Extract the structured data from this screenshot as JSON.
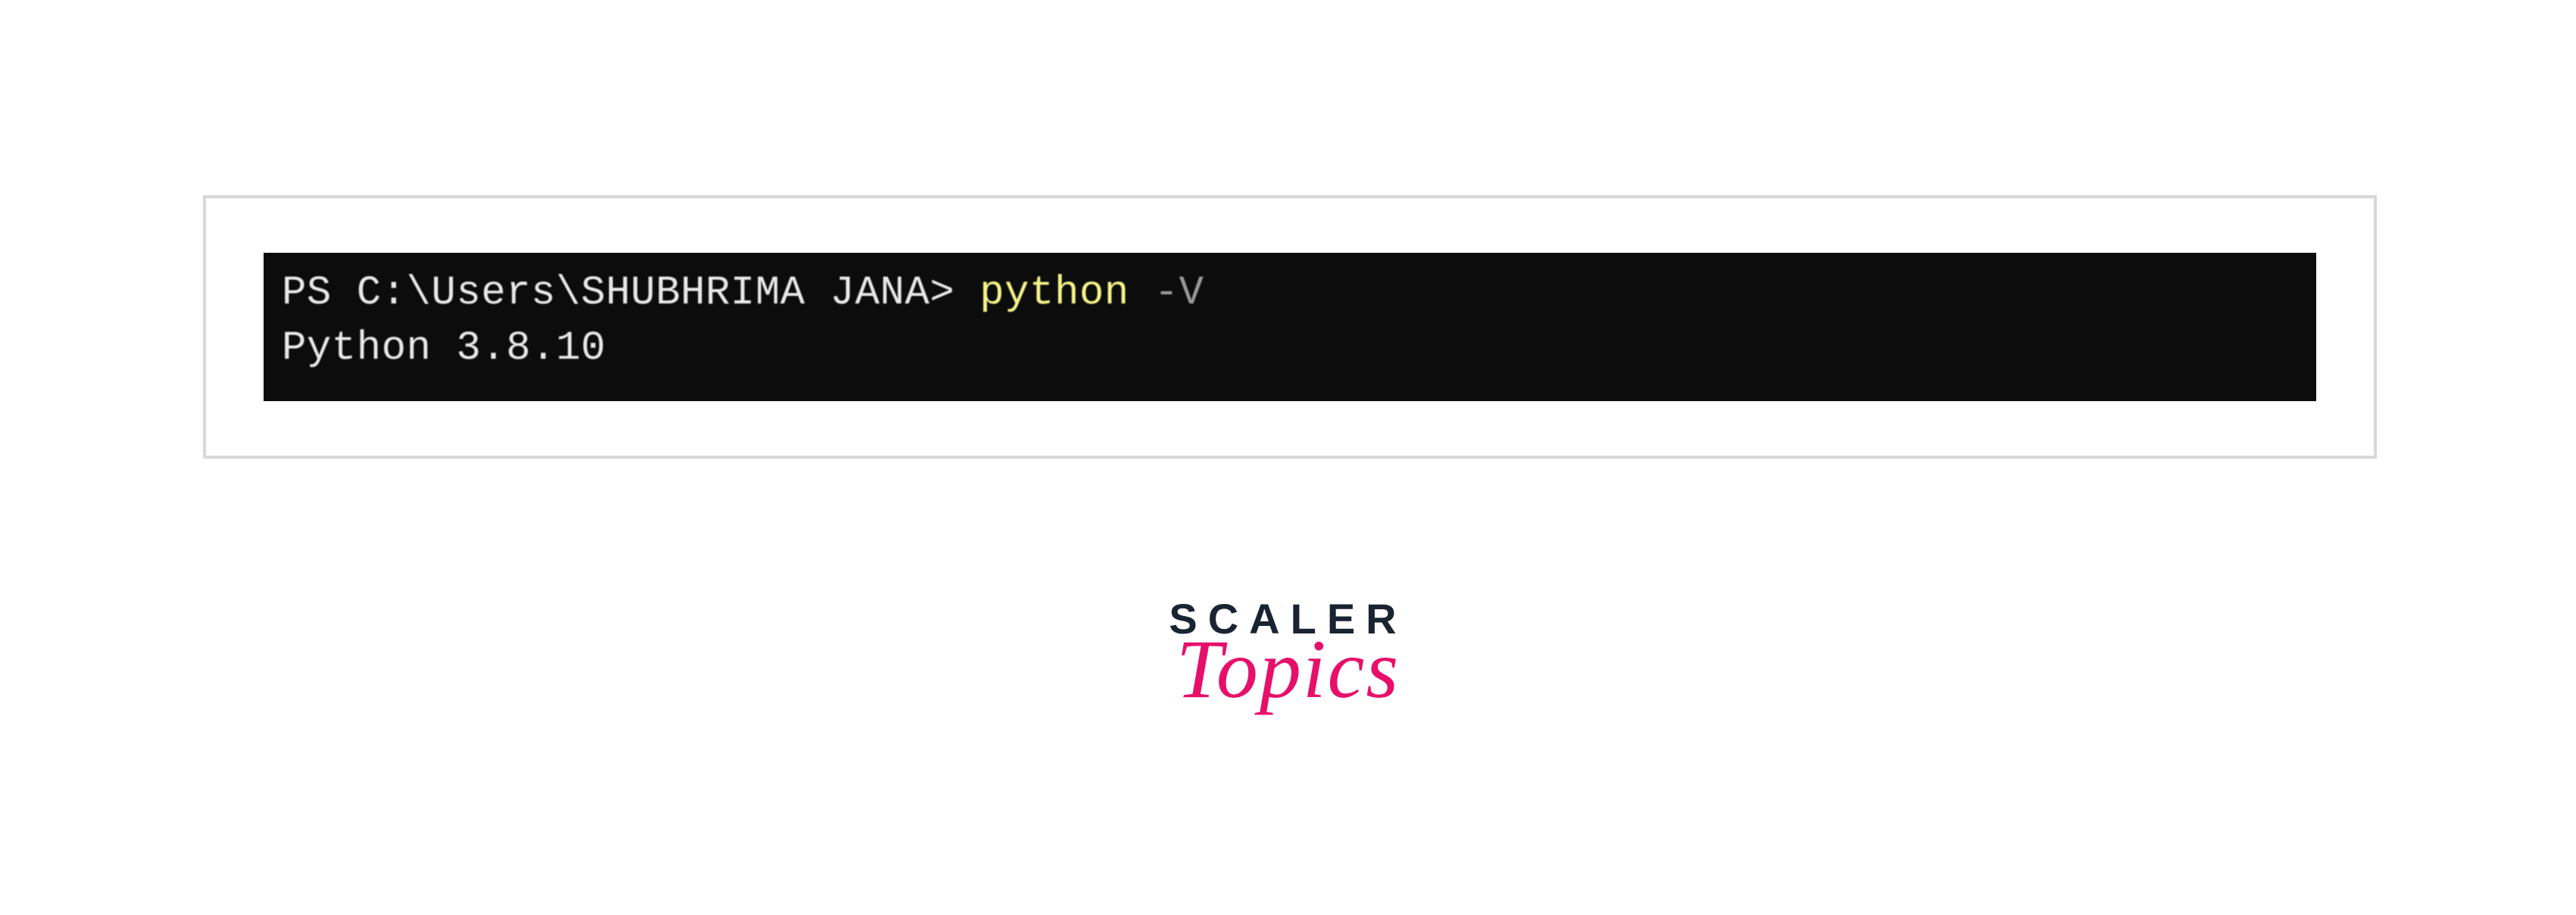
{
  "terminal": {
    "prompt": "PS C:\\Users\\SHUBHRIMA JANA> ",
    "command": "python",
    "flag": " -V",
    "output": "Python 3.8.10"
  },
  "logo": {
    "line1": "SCALER",
    "line2": "Topics"
  }
}
